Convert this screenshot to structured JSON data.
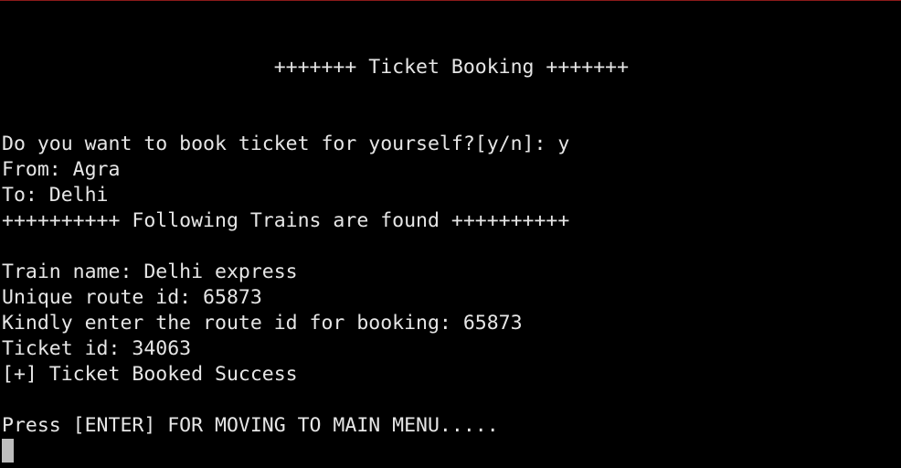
{
  "terminal": {
    "lines": {
      "title": "                       +++++++ Ticket Booking +++++++",
      "prompt_self": "Do you want to book ticket for yourself?[y/n]: y",
      "from": "From: Agra",
      "to": "To: Delhi",
      "trains_found": "++++++++++ Following Trains are found ++++++++++",
      "train_name": "Train name: Delhi express",
      "route_id": "Unique route id: 65873",
      "enter_route": "Kindly enter the route id for booking: 65873",
      "ticket_id": "Ticket id: 34063",
      "booked": "[+] Ticket Booked Success",
      "press_enter": "Press [ENTER] FOR MOVING TO MAIN MENU....."
    },
    "colors": {
      "background": "#000000",
      "foreground": "#e6e6e6",
      "cursor": "#bdbdbd"
    }
  }
}
